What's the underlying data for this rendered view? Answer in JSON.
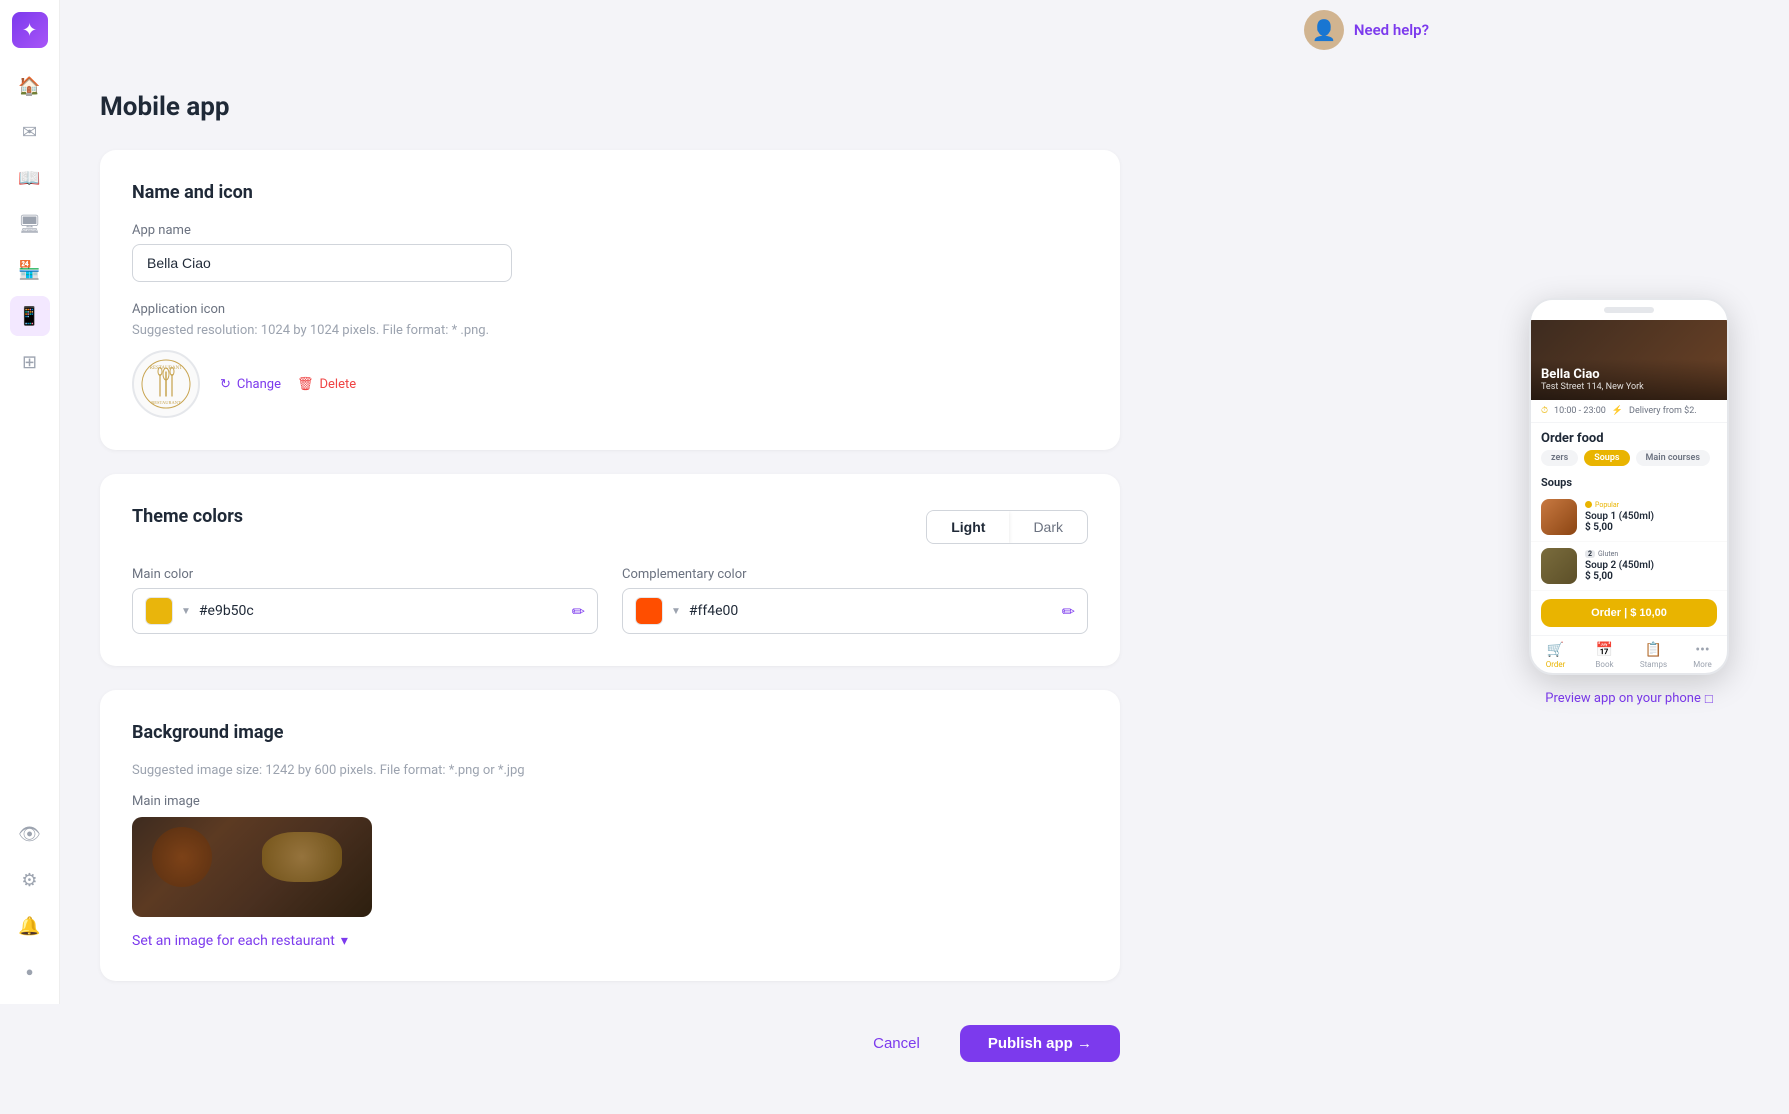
{
  "app": {
    "title": "Mobile app"
  },
  "sidebar": {
    "items": [
      {
        "id": "home",
        "icon": "🏠",
        "label": "Home"
      },
      {
        "id": "mail",
        "icon": "✉️",
        "label": "Mail"
      },
      {
        "id": "book",
        "icon": "📖",
        "label": "Book"
      },
      {
        "id": "monitor",
        "icon": "🖥️",
        "label": "Monitor"
      },
      {
        "id": "store",
        "icon": "🏪",
        "label": "Store"
      },
      {
        "id": "mobile",
        "icon": "📱",
        "label": "Mobile",
        "active": true
      },
      {
        "id": "grid",
        "icon": "⊞",
        "label": "Grid"
      },
      {
        "id": "more",
        "icon": "•••",
        "label": "More"
      }
    ]
  },
  "header": {
    "need_help_label": "Need help?",
    "avatar_emoji": "👤"
  },
  "name_icon_section": {
    "title": "Name and icon",
    "app_name_label": "App name",
    "app_name_value": "Bella Ciao",
    "app_name_placeholder": "App name",
    "application_icon_label": "Application icon",
    "application_icon_desc": "Suggested resolution: 1024 by 1024 pixels. File format: * .png.",
    "change_label": "Change",
    "delete_label": "Delete"
  },
  "theme_colors_section": {
    "title": "Theme colors",
    "light_label": "Light",
    "dark_label": "Dark",
    "main_color_label": "Main color",
    "main_color_value": "#e9b50c",
    "main_color_hex": "#e9b50c",
    "complementary_color_label": "Complementary color",
    "complementary_color_value": "#ff4e00",
    "complementary_color_hex": "#ff4e00"
  },
  "background_image_section": {
    "title": "Background image",
    "desc": "Suggested image size: 1242 by 600 pixels. File format: *.png or *.jpg",
    "main_image_label": "Main image",
    "set_image_label": "Set an image for each restaurant"
  },
  "bottom_actions": {
    "cancel_label": "Cancel",
    "publish_label": "Publish app →"
  },
  "phone_preview": {
    "restaurant_name": "Bella Ciao",
    "restaurant_address": "Test Street 114, New York",
    "hours": "10:00 - 23:00",
    "delivery_label": "Delivery from $2.",
    "order_food_label": "Order food",
    "categories": [
      {
        "label": "zers",
        "active": false
      },
      {
        "label": "Soups",
        "active": true
      },
      {
        "label": "Main courses",
        "active": false
      }
    ],
    "section_title": "Soups",
    "items": [
      {
        "badge_label": "Popular",
        "name": "Soup 1 (450ml)",
        "price": "$ 5,00"
      },
      {
        "badge_label": "Gluten",
        "badge_number": "2",
        "name": "Soup 2 (450ml)",
        "price": "$ 5,00"
      }
    ],
    "order_btn_label": "Order | $ 10,00",
    "nav_items": [
      {
        "label": "Order",
        "icon": "🛒",
        "active": true
      },
      {
        "label": "Book",
        "icon": "📅",
        "active": false
      },
      {
        "label": "Stamps",
        "icon": "📋",
        "active": false
      },
      {
        "label": "More",
        "icon": "•••",
        "active": false
      }
    ],
    "preview_link": "Preview app on your phone"
  }
}
